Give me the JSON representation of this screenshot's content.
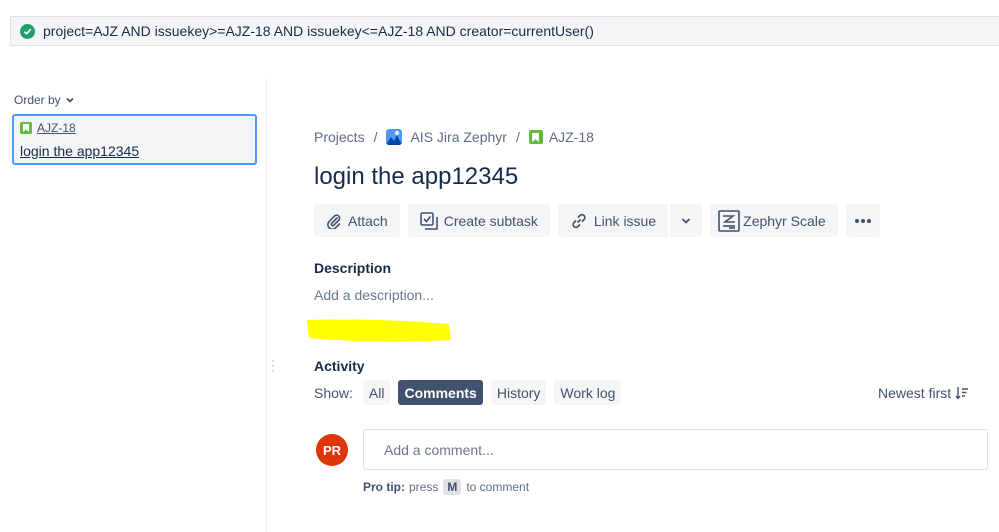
{
  "jql": {
    "query": "project=AJZ AND issuekey>=AJZ-18 AND issuekey<=AJZ-18 AND creator=currentUser()",
    "status_icon": "check-circle-icon"
  },
  "left_panel": {
    "order_by_label": "Order by",
    "issue_card": {
      "key": "AJZ-18",
      "summary": "login the app12345"
    }
  },
  "breadcrumbs": {
    "projects": "Projects",
    "project_name": "AIS Jira Zephyr",
    "issue_key": "AJZ-18"
  },
  "issue": {
    "title": "login the app12345"
  },
  "toolbar": {
    "attach": "Attach",
    "create_subtask": "Create subtask",
    "link_issue": "Link issue",
    "zephyr_scale": "Zephyr Scale"
  },
  "description": {
    "label": "Description",
    "placeholder": "Add a description..."
  },
  "activity": {
    "label": "Activity",
    "show_label": "Show:",
    "filters": [
      "All",
      "Comments",
      "History",
      "Work log"
    ],
    "selected_filter": "Comments",
    "sort_label": "Newest first"
  },
  "comment": {
    "avatar_initials": "PR",
    "placeholder": "Add a comment...",
    "pro_tip_label": "Pro tip:",
    "pro_tip_press": "press",
    "pro_tip_key": "M",
    "pro_tip_suffix": "to comment"
  },
  "colors": {
    "accent": "#42526e",
    "avatar": "#de350b",
    "story": "#63ba3c",
    "highlight": "#ffff00",
    "status_ok": "#22a06b"
  }
}
